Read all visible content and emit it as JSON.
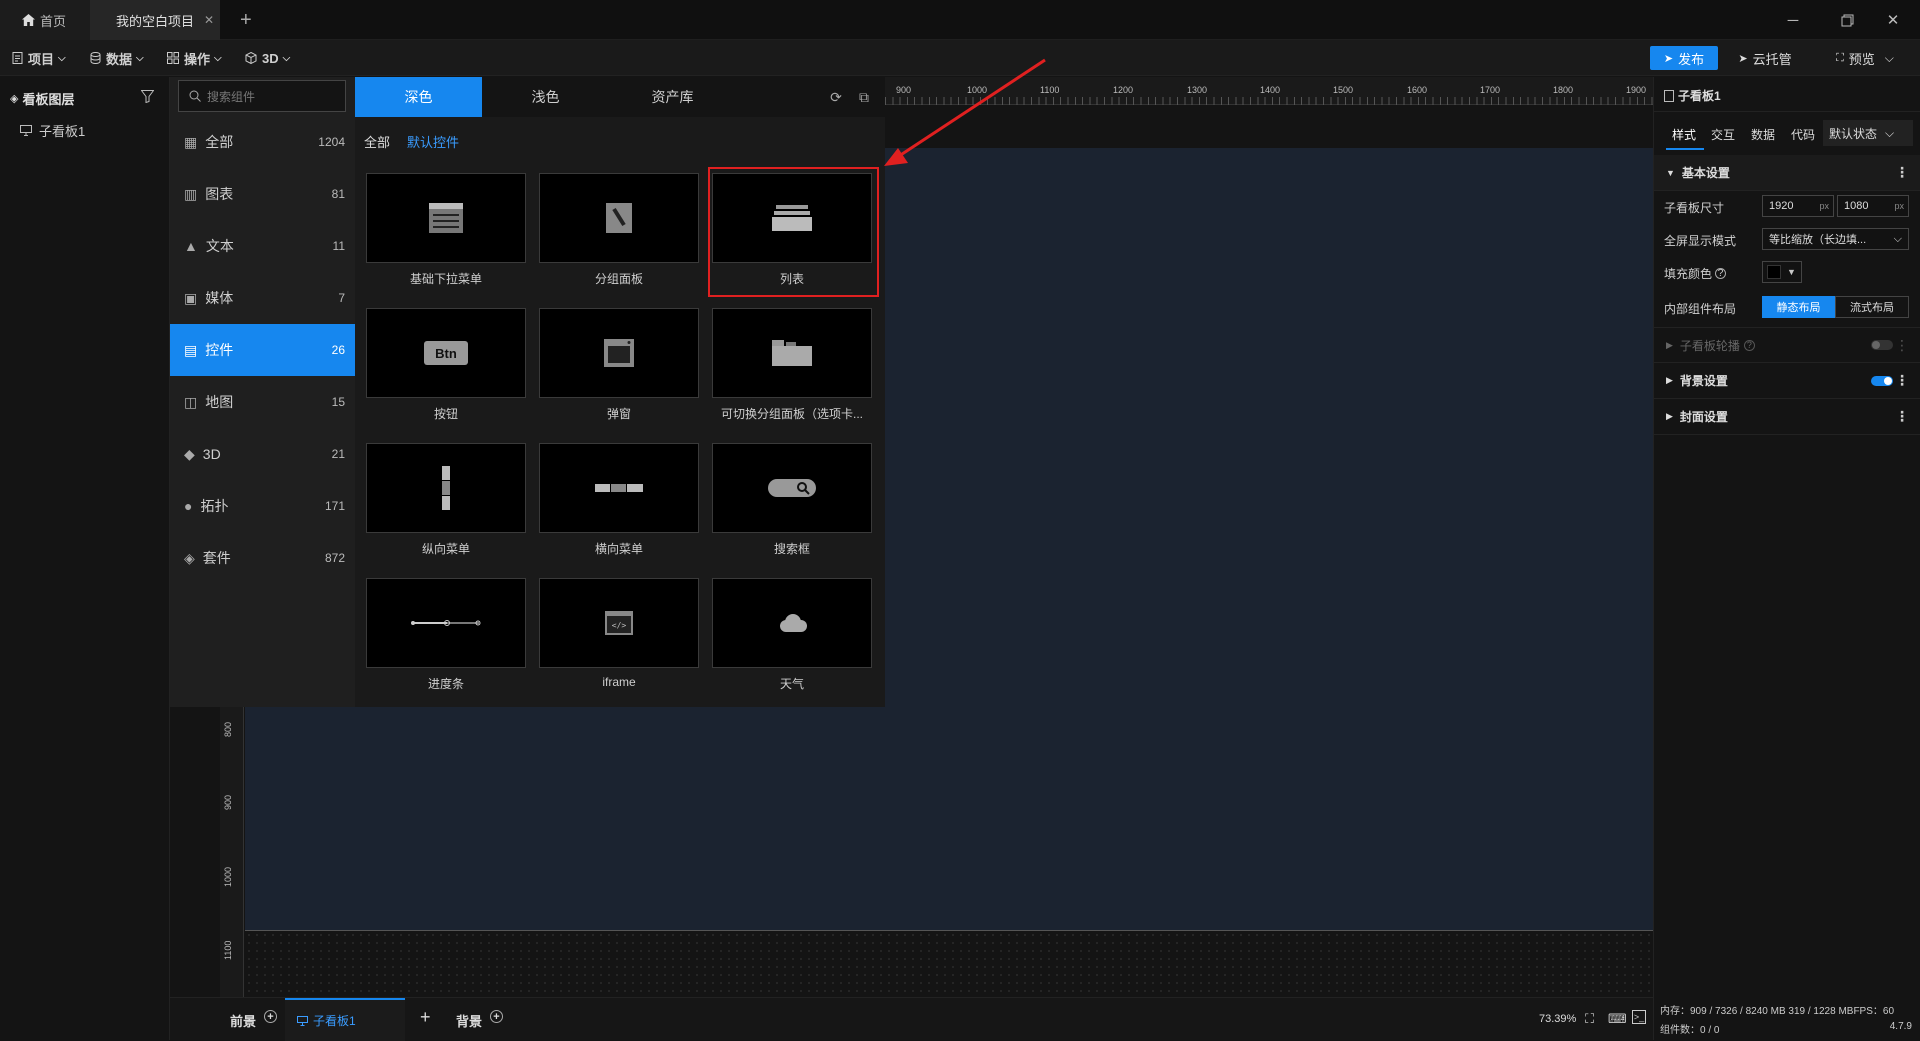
{
  "titlebar": {
    "home_tab": "首页",
    "project_tab": "我的空白项目"
  },
  "toolbar": {
    "project": "项目",
    "data": "数据",
    "operate": "操作",
    "three_d": "3D",
    "publish": "发布",
    "cloud": "云托管",
    "preview": "预览"
  },
  "layers": {
    "title": "看板图层",
    "items": [
      {
        "label": "子看板1"
      }
    ]
  },
  "components": {
    "search_placeholder": "搜索组件",
    "theme_tabs": [
      "深色",
      "浅色",
      "资产库"
    ],
    "filters": [
      "全部",
      "默认控件"
    ],
    "categories": [
      {
        "label": "全部",
        "count": "1204"
      },
      {
        "label": "图表",
        "count": "81"
      },
      {
        "label": "文本",
        "count": "11"
      },
      {
        "label": "媒体",
        "count": "7"
      },
      {
        "label": "控件",
        "count": "26"
      },
      {
        "label": "地图",
        "count": "15"
      },
      {
        "label": "3D",
        "count": "21"
      },
      {
        "label": "拓扑",
        "count": "171"
      },
      {
        "label": "套件",
        "count": "872"
      }
    ],
    "active_category": "控件",
    "cards": [
      {
        "label": "基础下拉菜单",
        "icon": "dropdown-icon"
      },
      {
        "label": "分组面板",
        "icon": "group-panel-icon"
      },
      {
        "label": "列表",
        "icon": "list-icon",
        "highlighted": true
      },
      {
        "label": "按钮",
        "icon": "button-icon",
        "text": "Btn"
      },
      {
        "label": "弹窗",
        "icon": "popup-icon"
      },
      {
        "label": "可切换分组面板（选项卡...",
        "icon": "tab-panel-icon"
      },
      {
        "label": "纵向菜单",
        "icon": "vertical-menu-icon"
      },
      {
        "label": "横向菜单",
        "icon": "horizontal-menu-icon"
      },
      {
        "label": "搜索框",
        "icon": "search-box-icon"
      },
      {
        "label": "进度条",
        "icon": "progress-icon"
      },
      {
        "label": "iframe",
        "icon": "iframe-icon"
      },
      {
        "label": "天气",
        "icon": "weather-icon"
      }
    ]
  },
  "ruler": {
    "top_ticks": [
      "900",
      "1000",
      "1100",
      "1200",
      "1300",
      "1400",
      "1500",
      "1600",
      "1700",
      "1800",
      "1900"
    ],
    "left_ticks": [
      "800",
      "900",
      "1000",
      "1100"
    ]
  },
  "bottom": {
    "foreground": "前景",
    "board_tab": "子看板1",
    "background": "背景",
    "zoom": "73.39%"
  },
  "props": {
    "title": "子看板1",
    "tabs": [
      "样式",
      "交互",
      "数据",
      "代码"
    ],
    "state": "默认状态",
    "basic_section": "基本设置",
    "size_label": "子看板尺寸",
    "width": "1920",
    "height": "1080",
    "unit": "px",
    "fullscreen_label": "全屏显示模式",
    "fullscreen_value": "等比缩放（长边填...",
    "fill_label": "填充颜色",
    "layout_label": "内部组件布局",
    "layout_static": "静态布局",
    "layout_flow": "流式布局",
    "carousel_section": "子看板轮播",
    "bg_section": "背景设置",
    "cover_section": "封面设置",
    "stats_memory": "内存：909 / 7326 / 8240 MB  319 / 1228 MBFPS：60",
    "stats_count": "组件数：0 / 0",
    "version": "4.7.9"
  },
  "colors": {
    "accent": "#1687ef",
    "highlight": "#e02020",
    "board": "#1b2330"
  }
}
